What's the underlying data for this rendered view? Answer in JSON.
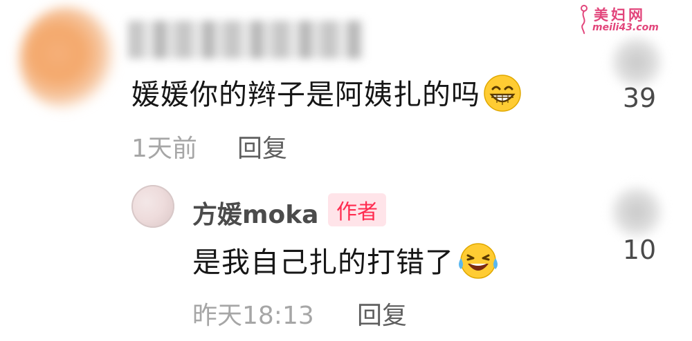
{
  "comments": [
    {
      "text": "媛媛你的辫子是阿姨扎的吗",
      "emoji": "grinning-face-emoji",
      "time": "1天前",
      "reply_label": "回复",
      "likes": "39"
    }
  ],
  "reply": {
    "author": "方媛moka",
    "badge": "作者",
    "text": "是我自己扎的打错了",
    "emoji": "laughing-tears-emoji",
    "time": "昨天18:13",
    "reply_label": "回复",
    "likes": "10"
  },
  "watermark": {
    "title": "美妇网",
    "url": "meili43.com"
  },
  "colors": {
    "badge_text": "#ff2b4f",
    "badge_bg": "#ffe4e9",
    "watermark": "#e2457b"
  }
}
